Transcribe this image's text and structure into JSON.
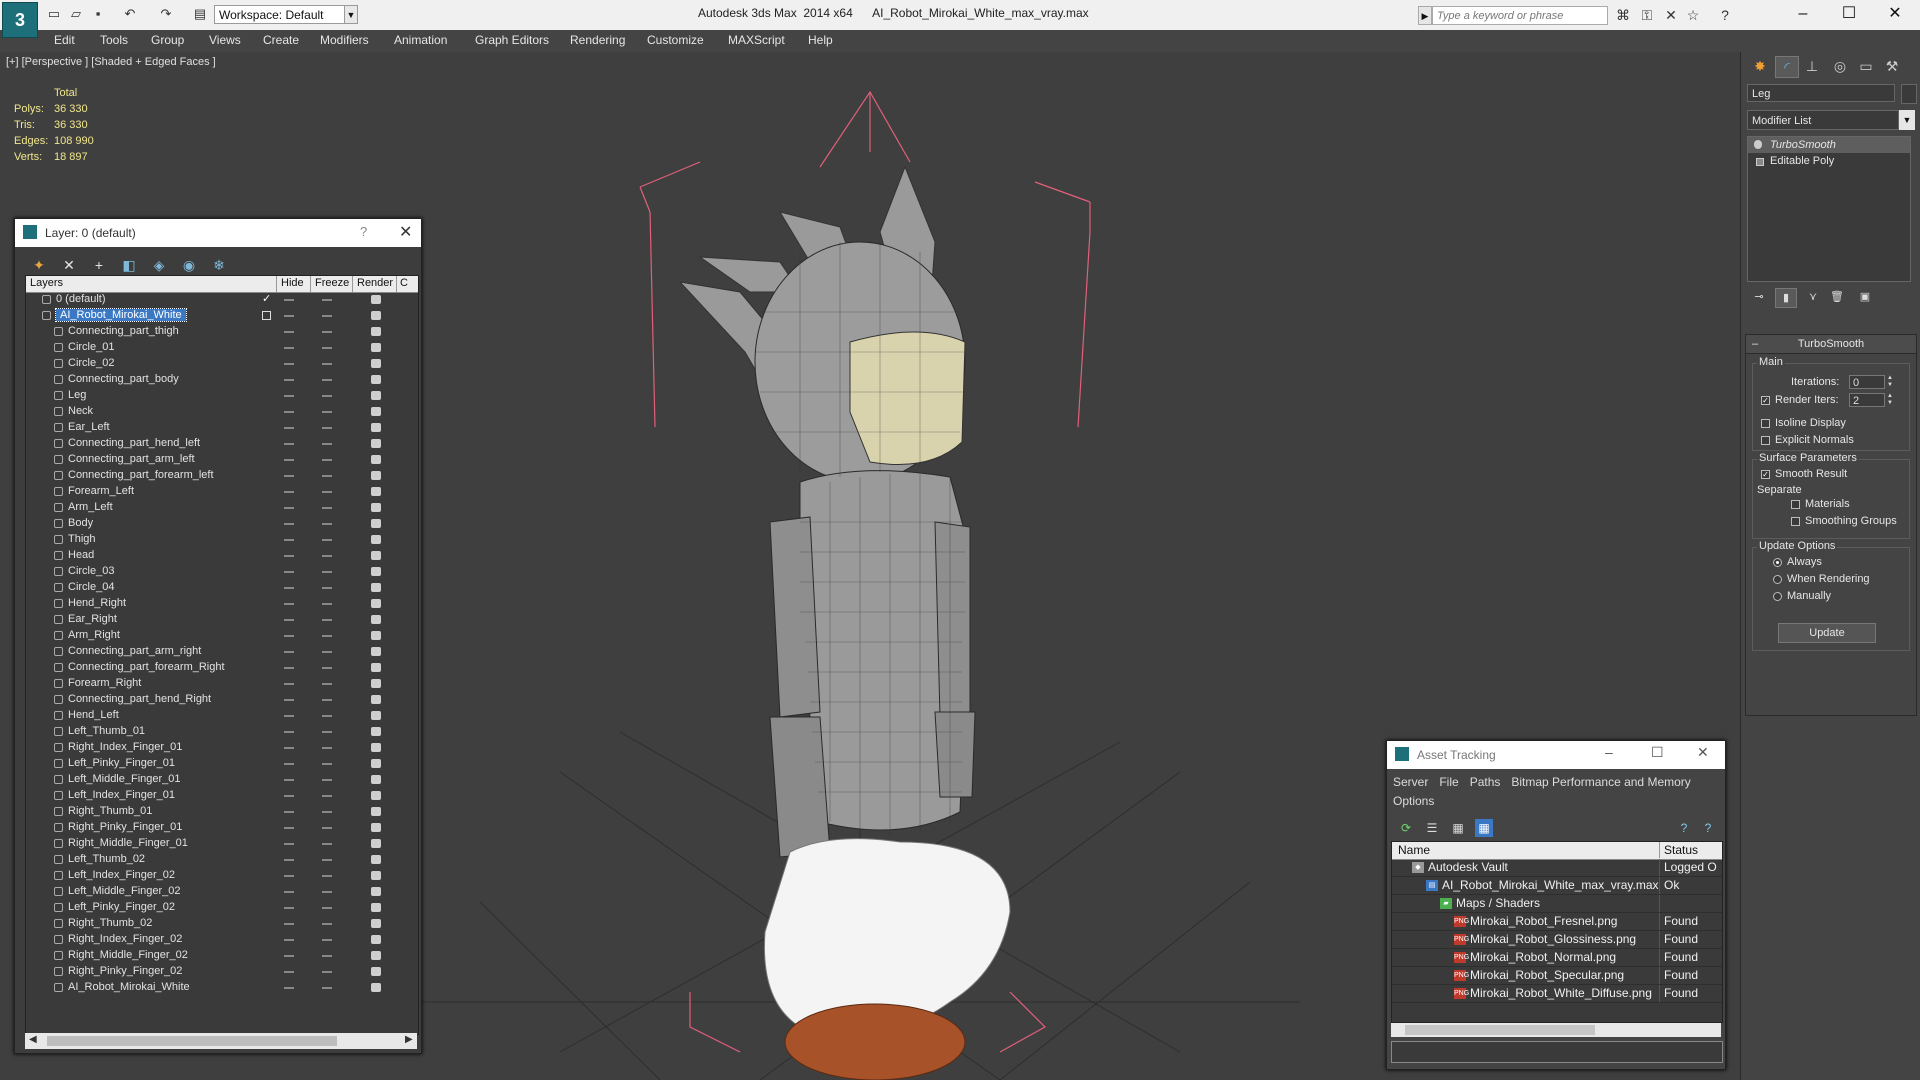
{
  "window": {
    "title": "Autodesk 3ds Max  2014 x64      AI_Robot_Mirokai_White_max_vray.max",
    "workspace": "Workspace: Default",
    "search_placeholder": "Type a keyword or phrase"
  },
  "menu": [
    "Edit",
    "Tools",
    "Group",
    "Views",
    "Create",
    "Modifiers",
    "Animation",
    "Graph Editors",
    "Rendering",
    "Customize",
    "MAXScript",
    "Help"
  ],
  "viewport": {
    "label": "[+] [Perspective ] [Shaded + Edged Faces ]",
    "stats": {
      "header": "Total",
      "polys_label": "Polys:",
      "polys": "36 330",
      "tris_label": "Tris:",
      "tris": "36 330",
      "edges_label": "Edges:",
      "edges": "108 990",
      "verts_label": "Verts:",
      "verts": "18 897"
    }
  },
  "layer_dialog": {
    "title": "Layer: 0 (default)",
    "help": "?",
    "columns": {
      "layers": "Layers",
      "hide": "Hide",
      "freeze": "Freeze",
      "render": "Render",
      "extra": "C"
    },
    "rows": [
      {
        "name": "0 (default)",
        "level": 0
      },
      {
        "name": "AI_Robot_Mirokai_White",
        "level": 0
      },
      {
        "name": "Connecting_part_thigh",
        "level": 1
      },
      {
        "name": "Circle_01",
        "level": 1
      },
      {
        "name": "Circle_02",
        "level": 1
      },
      {
        "name": "Connecting_part_body",
        "level": 1
      },
      {
        "name": "Leg",
        "level": 1
      },
      {
        "name": "Neck",
        "level": 1
      },
      {
        "name": "Ear_Left",
        "level": 1
      },
      {
        "name": "Connecting_part_hend_left",
        "level": 1
      },
      {
        "name": "Connecting_part_arm_left",
        "level": 1
      },
      {
        "name": "Connecting_part_forearm_left",
        "level": 1
      },
      {
        "name": "Forearm_Left",
        "level": 1
      },
      {
        "name": "Arm_Left",
        "level": 1
      },
      {
        "name": "Body",
        "level": 1
      },
      {
        "name": "Thigh",
        "level": 1
      },
      {
        "name": "Head",
        "level": 1
      },
      {
        "name": "Circle_03",
        "level": 1
      },
      {
        "name": "Circle_04",
        "level": 1
      },
      {
        "name": "Hend_Right",
        "level": 1
      },
      {
        "name": "Ear_Right",
        "level": 1
      },
      {
        "name": "Arm_Right",
        "level": 1
      },
      {
        "name": "Connecting_part_arm_right",
        "level": 1
      },
      {
        "name": "Connecting_part_forearm_Right",
        "level": 1
      },
      {
        "name": "Forearm_Right",
        "level": 1
      },
      {
        "name": "Connecting_part_hend_Right",
        "level": 1
      },
      {
        "name": "Hend_Left",
        "level": 1
      },
      {
        "name": "Left_Thumb_01",
        "level": 1
      },
      {
        "name": "Right_Index_Finger_01",
        "level": 1
      },
      {
        "name": "Left_Pinky_Finger_01",
        "level": 1
      },
      {
        "name": "Left_Middle_Finger_01",
        "level": 1
      },
      {
        "name": "Left_Index_Finger_01",
        "level": 1
      },
      {
        "name": "Right_Thumb_01",
        "level": 1
      },
      {
        "name": "Right_Pinky_Finger_01",
        "level": 1
      },
      {
        "name": "Right_Middle_Finger_01",
        "level": 1
      },
      {
        "name": "Left_Thumb_02",
        "level": 1
      },
      {
        "name": "Left_Index_Finger_02",
        "level": 1
      },
      {
        "name": "Left_Middle_Finger_02",
        "level": 1
      },
      {
        "name": "Left_Pinky_Finger_02",
        "level": 1
      },
      {
        "name": "Right_Thumb_02",
        "level": 1
      },
      {
        "name": "Right_Index_Finger_02",
        "level": 1
      },
      {
        "name": "Right_Middle_Finger_02",
        "level": 1
      },
      {
        "name": "Right_Pinky_Finger_02",
        "level": 1
      },
      {
        "name": "AI_Robot_Mirokai_White",
        "level": 1
      }
    ],
    "selected_row": 1
  },
  "asset_dialog": {
    "title": "Asset Tracking",
    "menu": [
      "Server",
      "File",
      "Paths",
      "Bitmap Performance and Memory",
      "Options"
    ],
    "columns": {
      "name": "Name",
      "status": "Status"
    },
    "rows": [
      {
        "name": "Autodesk Vault",
        "status": "Logged O",
        "indent": 1,
        "icon": "vault-icon"
      },
      {
        "name": "AI_Robot_Mirokai_White_max_vray.max",
        "status": "Ok",
        "indent": 2,
        "icon": "max-file-icon"
      },
      {
        "name": "Maps / Shaders",
        "status": "",
        "indent": 3,
        "icon": "maps-icon"
      },
      {
        "name": "Mirokai_Robot_Fresnel.png",
        "status": "Found",
        "indent": 4,
        "icon": "png-icon"
      },
      {
        "name": "Mirokai_Robot_Glossiness.png",
        "status": "Found",
        "indent": 4,
        "icon": "png-icon"
      },
      {
        "name": "Mirokai_Robot_Normal.png",
        "status": "Found",
        "indent": 4,
        "icon": "png-icon"
      },
      {
        "name": "Mirokai_Robot_Specular.png",
        "status": "Found",
        "indent": 4,
        "icon": "png-icon"
      },
      {
        "name": "Mirokai_Robot_White_Diffuse.png",
        "status": "Found",
        "indent": 4,
        "icon": "png-icon"
      }
    ]
  },
  "command_panel": {
    "object_name": "Leg",
    "modifier_list": "Modifier List",
    "stack": [
      {
        "name": "TurboSmooth",
        "selected": true
      },
      {
        "name": "Editable Poly",
        "selected": false
      }
    ],
    "rollout": {
      "title": "TurboSmooth",
      "main_label": "Main",
      "iterations_label": "Iterations:",
      "iterations": "0",
      "render_iters_label": "Render Iters:",
      "render_iters": "2",
      "isoline": "Isoline Display",
      "explicit_normals": "Explicit Normals",
      "surface_params": "Surface Parameters",
      "smooth_result": "Smooth Result",
      "separate": "Separate",
      "materials": "Materials",
      "smoothing_groups": "Smoothing Groups",
      "update_options": "Update Options",
      "always": "Always",
      "when_rendering": "When Rendering",
      "manually": "Manually",
      "update_button": "Update"
    }
  },
  "colors": {
    "stats_text": "#f0e68c",
    "selection": "#3b78c4",
    "bounding_box": "#e0607a",
    "grid": "#2e2e2e"
  }
}
